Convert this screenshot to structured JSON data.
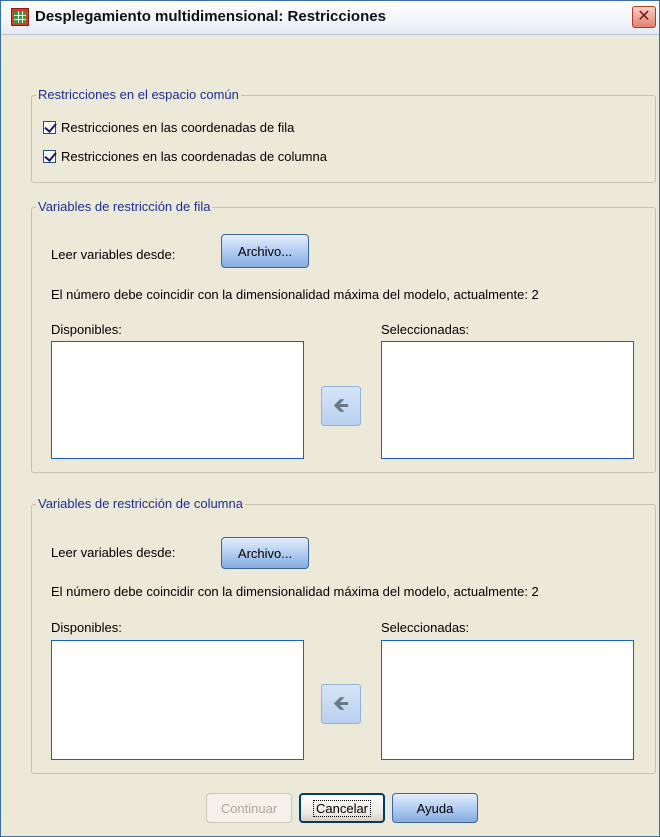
{
  "window": {
    "title": "Desplegamiento multidimensional: Restricciones",
    "close_glyph": "✕",
    "icon": "spreadsheet-icon"
  },
  "common_space": {
    "group_label": "Restricciones en el espacio común",
    "row_coords": {
      "label": "Restricciones en las coordenadas de fila",
      "checked": true
    },
    "col_coords": {
      "label": "Restricciones en las coordenadas de columna",
      "checked": true
    }
  },
  "row_vars": {
    "group_label": "Variables de restricción de fila",
    "read_label": "Leer variables desde:",
    "file_button": "Archivo...",
    "note": "El número debe coincidir con la dimensionalidad máxima del modelo, actualmente:  2",
    "available_label": "Disponibles:",
    "selected_label": "Seleccionadas:",
    "move_glyph": "🡸"
  },
  "col_vars": {
    "group_label": "Variables de restricción de columna",
    "read_label": "Leer variables desde:",
    "file_button": "Archivo...",
    "note": "El número debe coincidir con la dimensionalidad máxima del modelo, actualmente:  2",
    "available_label": "Disponibles:",
    "selected_label": "Seleccionadas:",
    "move_glyph": "🡸"
  },
  "footer": {
    "continue": "Continuar",
    "cancel": "Cancelar",
    "help": "Ayuda"
  },
  "colors": {
    "group_label": "#1d2d9c",
    "listbox_border": "#1c5ec4",
    "dialog_bg": "#ece9d8"
  }
}
